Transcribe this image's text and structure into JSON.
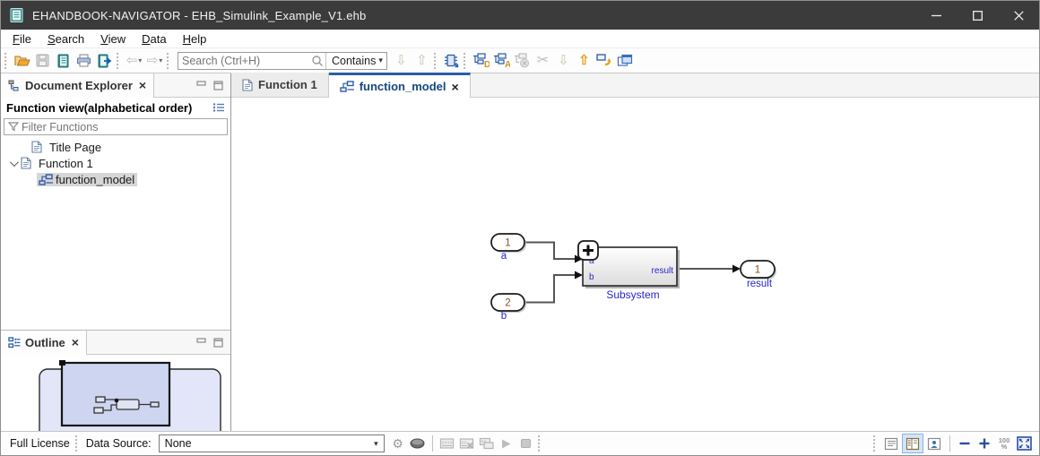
{
  "window": {
    "title": "EHANDBOOK-NAVIGATOR - EHB_Simulink_Example_V1.ehb",
    "controls": [
      "minimize-icon",
      "maximize-icon",
      "close-icon"
    ],
    "titlebar_color": "#3b3b3b"
  },
  "menu": {
    "items": [
      "File",
      "Search",
      "View",
      "Data",
      "Help"
    ]
  },
  "toolbar": {
    "search_placeholder": "Search (Ctrl+H)",
    "contains_label": "Contains",
    "icon_names": [
      "folder-open-icon",
      "save-icon",
      "handbook-icon",
      "print-icon",
      "export-handbook-icon",
      "nav-back-icon",
      "nav-back-dropdown-icon",
      "nav-forward-icon",
      "nav-forward-dropdown-icon",
      "search-icon",
      "contains-dropdown-icon",
      "next-result-icon",
      "previous-result-icon",
      "model-chip-icon",
      "show-definition-icon",
      "show-alias-icon",
      "definition-disabled-icon",
      "cut-icon",
      "step-into-icon",
      "step-out-icon",
      "go-to-parent-icon",
      "new-window-icon"
    ]
  },
  "explorer": {
    "tab_title": "Document Explorer",
    "tab_icon": "tree-view-icon",
    "view_header": "Function view(alphabetical order)",
    "header_icon": "list-view-icon",
    "filter_placeholder": "Filter Functions",
    "filter_icon": "funnel-icon",
    "tree": [
      {
        "icon": "document-icon",
        "label": "Title Page",
        "selected": false
      },
      {
        "icon": "document-icon",
        "label": "Function 1",
        "selected": false,
        "expanded": true
      },
      {
        "icon": "model-icon",
        "label": "function_model",
        "selected": true
      }
    ]
  },
  "outline": {
    "tab_title": "Outline",
    "tab_icon": "outline-icon",
    "thumbnail": {
      "background_fill": "#e2e6f8",
      "viewport_fill": "#cdd5f0",
      "description": "miniature of function_model diagram with viewport rectangle"
    }
  },
  "editor": {
    "tabs": [
      {
        "icon": "document-icon",
        "label": "Function 1",
        "active": false
      },
      {
        "icon": "model-icon",
        "label": "function_model",
        "active": true,
        "closable": true
      }
    ]
  },
  "diagram": {
    "inport1": {
      "number": "1",
      "label": "a"
    },
    "inport2": {
      "number": "2",
      "label": "b"
    },
    "subsystem": {
      "label": "Subsystem",
      "port_a": "a",
      "port_b": "b",
      "port_result": "result",
      "badge": "plus-expand-icon"
    },
    "outport1": {
      "number": "1",
      "label": "result"
    },
    "label_color": "#2626cf",
    "port_number_color": "#8a4d1e"
  },
  "statusbar": {
    "license": "Full License",
    "data_source_label": "Data Source:",
    "data_source_value": "None",
    "zoom_top": "100",
    "zoom_bottom": "%",
    "icon_names": [
      "gear-icon",
      "disc-icon",
      "measure-icon",
      "measure-disabled-icon",
      "measure-config-icon",
      "play-icon",
      "stop-icon",
      "document-view-icon",
      "split-view-icon",
      "person-view-icon",
      "zoom-out-icon",
      "zoom-in-icon",
      "zoom-level-icon",
      "fit-screen-icon"
    ],
    "active_view": "split-view"
  },
  "colors": {
    "accent_blue": "#2a5caa",
    "tab_text_blue": "#17477e",
    "selection_gray": "#d6d6d6",
    "wire_gray": "#555555"
  }
}
